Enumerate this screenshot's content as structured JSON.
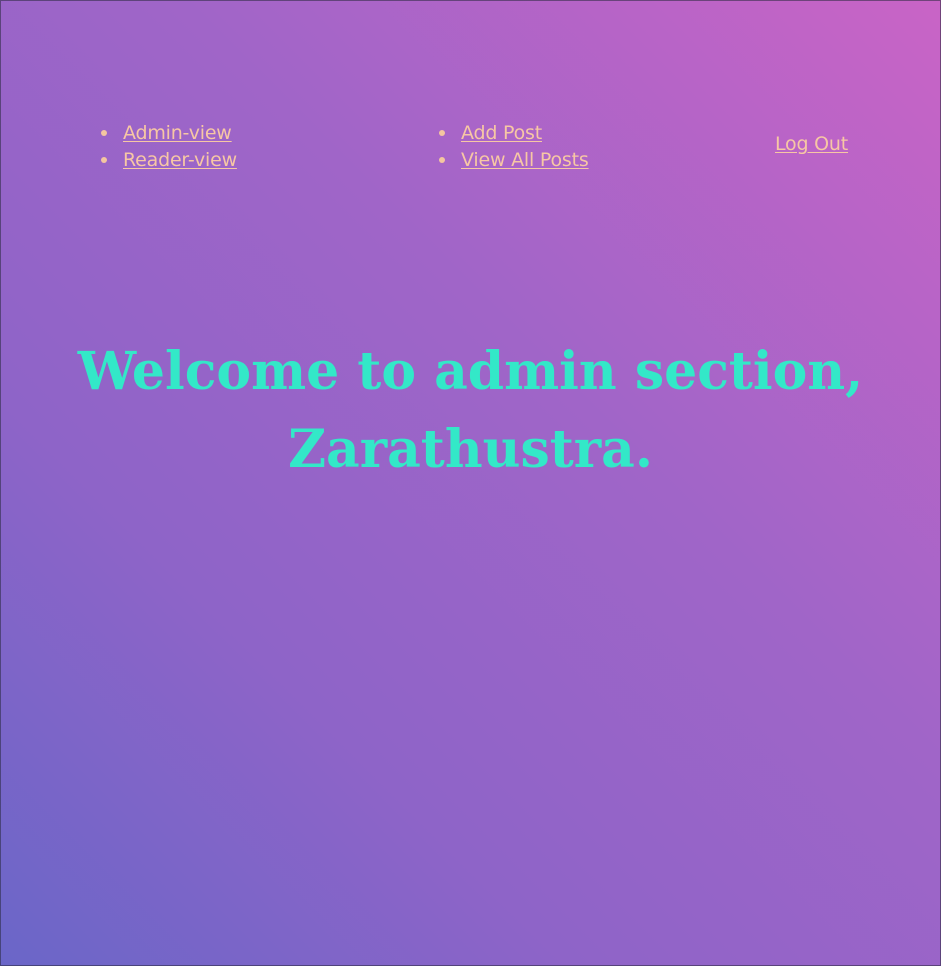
{
  "nav": {
    "view_links": [
      {
        "label": "Admin-view"
      },
      {
        "label": "Reader-view"
      }
    ],
    "post_links": [
      {
        "label": "Add Post"
      },
      {
        "label": "View All Posts"
      }
    ],
    "logout_label": "Log Out"
  },
  "main": {
    "heading": "Welcome to admin section, Zarathustra."
  },
  "colors": {
    "link": "#f7c7a4",
    "heading": "#33e8c8",
    "gradient_top_right": "#c964c6",
    "gradient_bottom_left": "#6a66c8"
  }
}
